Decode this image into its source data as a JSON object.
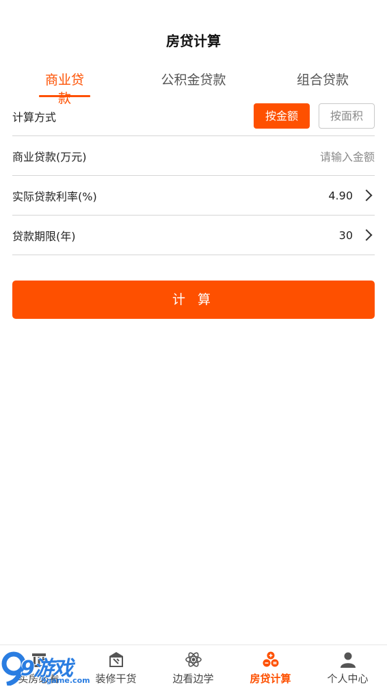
{
  "header": {
    "title": "房贷计算"
  },
  "tabs": [
    {
      "label": "商业贷款",
      "active": true
    },
    {
      "label": "公积金贷款",
      "active": false
    },
    {
      "label": "组合贷款",
      "active": false
    }
  ],
  "form": {
    "method": {
      "label": "计算方式",
      "by_amount": "按金额",
      "by_area": "按面积",
      "selected": "按金额"
    },
    "loan_amount": {
      "label": "商业贷款(万元)",
      "placeholder": "请输入金额"
    },
    "rate": {
      "label": "实际贷款利率(%)",
      "value": "4.90"
    },
    "term": {
      "label": "贷款期限(年)",
      "value": "30"
    }
  },
  "calculate_button": "计 算",
  "bottom_nav": [
    {
      "label": "买房必看",
      "icon": "building-icon"
    },
    {
      "label": "装修干货",
      "icon": "hammer-board-icon"
    },
    {
      "label": "边看边学",
      "icon": "atom-icon"
    },
    {
      "label": "房贷计算",
      "icon": "calculator-icon",
      "active": true
    },
    {
      "label": "个人中心",
      "icon": "person-icon"
    }
  ],
  "watermark": {
    "main": "9游戏",
    "sub": "9game.com"
  },
  "colors": {
    "accent": "#fe5000",
    "divider": "#d6d6d6",
    "muted": "#8a8a8a"
  }
}
